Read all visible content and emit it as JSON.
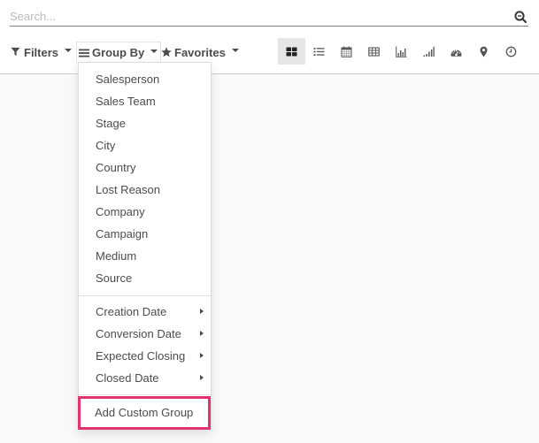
{
  "search": {
    "placeholder": "Search...",
    "value": "",
    "icon": "search-icon"
  },
  "toolbar": {
    "filters_label": "Filters",
    "groupby_label": "Group By",
    "favorites_label": "Favorites"
  },
  "views": [
    {
      "name": "kanban",
      "icon": "kanban-icon",
      "active": true
    },
    {
      "name": "list",
      "icon": "list-icon",
      "active": false
    },
    {
      "name": "calendar",
      "icon": "calendar-icon",
      "active": false
    },
    {
      "name": "pivot",
      "icon": "table-icon",
      "active": false
    },
    {
      "name": "graph",
      "icon": "bar-chart-icon",
      "active": false
    },
    {
      "name": "cohort",
      "icon": "signal-icon",
      "active": false
    },
    {
      "name": "dashboard",
      "icon": "dashboard-icon",
      "active": false
    },
    {
      "name": "map",
      "icon": "map-marker-icon",
      "active": false
    },
    {
      "name": "activity",
      "icon": "clock-icon",
      "active": false
    }
  ],
  "groupby_menu": {
    "fields": [
      {
        "label": "Salesperson"
      },
      {
        "label": "Sales Team"
      },
      {
        "label": "Stage"
      },
      {
        "label": "City"
      },
      {
        "label": "Country"
      },
      {
        "label": "Lost Reason"
      },
      {
        "label": "Company"
      },
      {
        "label": "Campaign"
      },
      {
        "label": "Medium"
      },
      {
        "label": "Source"
      }
    ],
    "date_fields": [
      {
        "label": "Creation Date"
      },
      {
        "label": "Conversion Date"
      },
      {
        "label": "Expected Closing"
      },
      {
        "label": "Closed Date"
      }
    ],
    "custom_group_label": "Add Custom Group",
    "highlight_color": "#e0336f"
  }
}
